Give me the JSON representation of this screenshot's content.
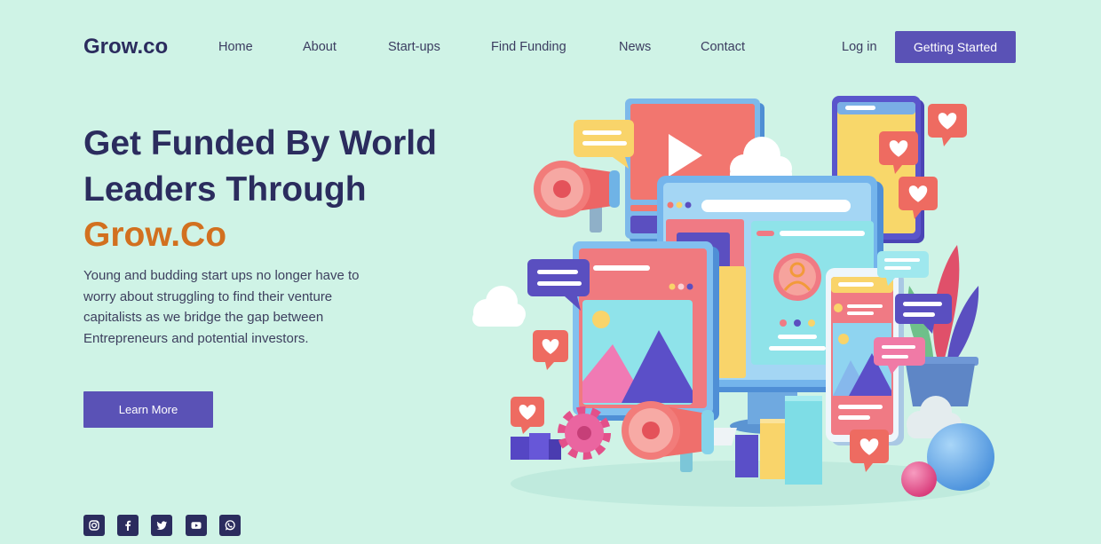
{
  "brand": {
    "logo": "Grow.co"
  },
  "nav": {
    "items": [
      {
        "label": "Home"
      },
      {
        "label": "About"
      },
      {
        "label": "Start-ups"
      },
      {
        "label": "Find Funding"
      },
      {
        "label": "News"
      },
      {
        "label": "Contact"
      }
    ],
    "login_label": "Log in",
    "cta_label": "Getting Started"
  },
  "hero": {
    "title_line1": "Get Funded By World",
    "title_line2": "Leaders Through",
    "title_highlight": "Grow.Co",
    "description": "Young and budding start ups no longer have to worry about struggling to find their venture capitalists as we bridge the gap between Entrepreneurs and potential investors.",
    "button_label": "Learn More"
  },
  "social": {
    "icons": [
      "instagram-icon",
      "facebook-icon",
      "twitter-icon",
      "youtube-icon",
      "whatsapp-icon"
    ]
  },
  "illustration": {
    "icon": "digital-marketing-illustration"
  },
  "colors": {
    "background": "#cff3e6",
    "primary": "#5a52b6",
    "heading": "#2b2c5e",
    "accent": "#d2701f"
  }
}
